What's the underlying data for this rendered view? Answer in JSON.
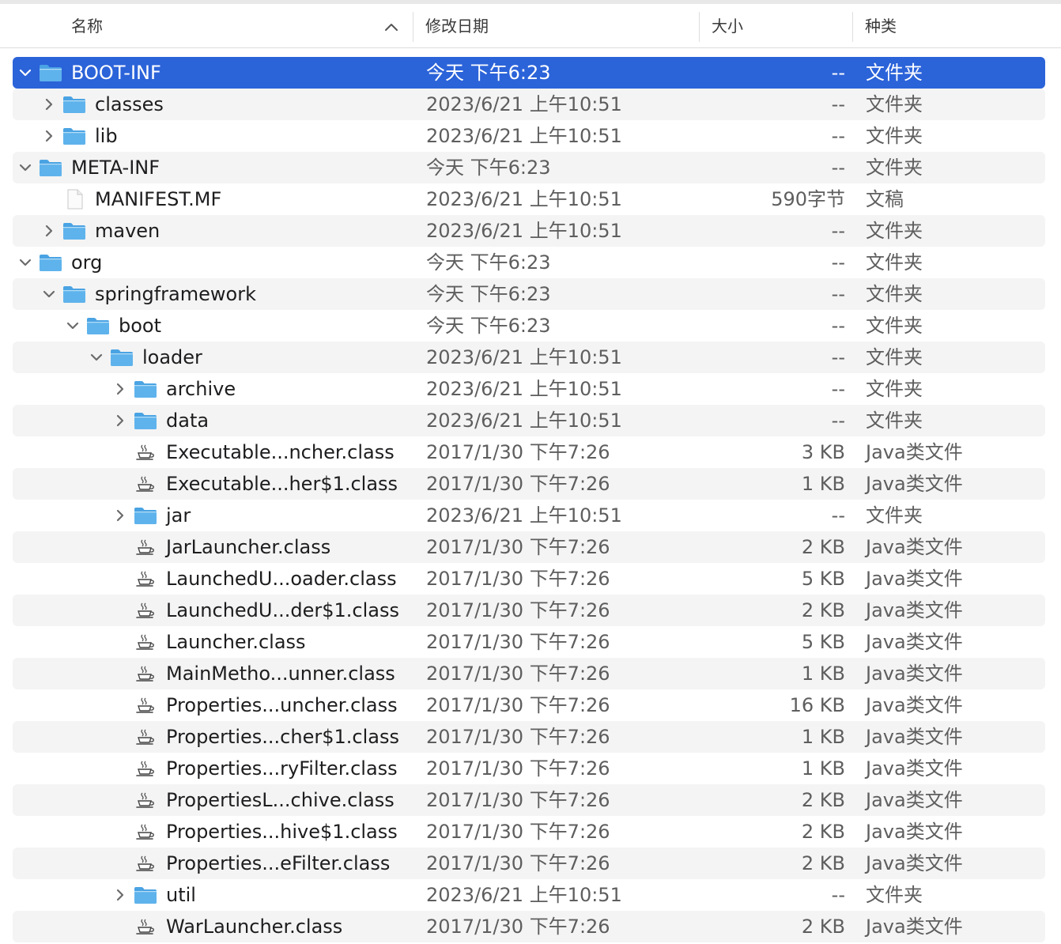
{
  "columns": {
    "name": "名称",
    "date": "修改日期",
    "size": "大小",
    "kind": "种类"
  },
  "colors": {
    "selection": "#2b63d9",
    "folder": "#5fb3ec",
    "stripe": "#f4f4f4"
  },
  "rows": [
    {
      "name": "BOOT-INF",
      "date": "今天 下午6:23",
      "size": "--",
      "kind": "文件夹",
      "depth": 0,
      "type": "folder",
      "chevron": "down",
      "selected": true
    },
    {
      "name": "classes",
      "date": "2023/6/21 上午10:51",
      "size": "--",
      "kind": "文件夹",
      "depth": 1,
      "type": "folder",
      "chevron": "right"
    },
    {
      "name": "lib",
      "date": "2023/6/21 上午10:51",
      "size": "--",
      "kind": "文件夹",
      "depth": 1,
      "type": "folder",
      "chevron": "right"
    },
    {
      "name": "META-INF",
      "date": "今天 下午6:23",
      "size": "--",
      "kind": "文件夹",
      "depth": 0,
      "type": "folder",
      "chevron": "down"
    },
    {
      "name": "MANIFEST.MF",
      "date": "2023/6/21 上午10:51",
      "size": "590字节",
      "kind": "文稿",
      "depth": 1,
      "type": "doc",
      "chevron": "none"
    },
    {
      "name": "maven",
      "date": "2023/6/21 上午10:51",
      "size": "--",
      "kind": "文件夹",
      "depth": 1,
      "type": "folder",
      "chevron": "right"
    },
    {
      "name": "org",
      "date": "今天 下午6:23",
      "size": "--",
      "kind": "文件夹",
      "depth": 0,
      "type": "folder",
      "chevron": "down"
    },
    {
      "name": "springframework",
      "date": "今天 下午6:23",
      "size": "--",
      "kind": "文件夹",
      "depth": 1,
      "type": "folder",
      "chevron": "down"
    },
    {
      "name": "boot",
      "date": "今天 下午6:23",
      "size": "--",
      "kind": "文件夹",
      "depth": 2,
      "type": "folder",
      "chevron": "down"
    },
    {
      "name": "loader",
      "date": "2023/6/21 上午10:51",
      "size": "--",
      "kind": "文件夹",
      "depth": 3,
      "type": "folder",
      "chevron": "down"
    },
    {
      "name": "archive",
      "date": "2023/6/21 上午10:51",
      "size": "--",
      "kind": "文件夹",
      "depth": 4,
      "type": "folder",
      "chevron": "right"
    },
    {
      "name": "data",
      "date": "2023/6/21 上午10:51",
      "size": "--",
      "kind": "文件夹",
      "depth": 4,
      "type": "folder",
      "chevron": "right"
    },
    {
      "name": "Executable...ncher.class",
      "date": "2017/1/30 下午7:26",
      "size": "3 KB",
      "kind": "Java类文件",
      "depth": 4,
      "type": "java",
      "chevron": "none"
    },
    {
      "name": "Executable...her$1.class",
      "date": "2017/1/30 下午7:26",
      "size": "1 KB",
      "kind": "Java类文件",
      "depth": 4,
      "type": "java",
      "chevron": "none"
    },
    {
      "name": "jar",
      "date": "2023/6/21 上午10:51",
      "size": "--",
      "kind": "文件夹",
      "depth": 4,
      "type": "folder",
      "chevron": "right"
    },
    {
      "name": "JarLauncher.class",
      "date": "2017/1/30 下午7:26",
      "size": "2 KB",
      "kind": "Java类文件",
      "depth": 4,
      "type": "java",
      "chevron": "none"
    },
    {
      "name": "LaunchedU...oader.class",
      "date": "2017/1/30 下午7:26",
      "size": "5 KB",
      "kind": "Java类文件",
      "depth": 4,
      "type": "java",
      "chevron": "none"
    },
    {
      "name": "LaunchedU...der$1.class",
      "date": "2017/1/30 下午7:26",
      "size": "2 KB",
      "kind": "Java类文件",
      "depth": 4,
      "type": "java",
      "chevron": "none"
    },
    {
      "name": "Launcher.class",
      "date": "2017/1/30 下午7:26",
      "size": "5 KB",
      "kind": "Java类文件",
      "depth": 4,
      "type": "java",
      "chevron": "none"
    },
    {
      "name": "MainMetho...unner.class",
      "date": "2017/1/30 下午7:26",
      "size": "1 KB",
      "kind": "Java类文件",
      "depth": 4,
      "type": "java",
      "chevron": "none"
    },
    {
      "name": "Properties...uncher.class",
      "date": "2017/1/30 下午7:26",
      "size": "16 KB",
      "kind": "Java类文件",
      "depth": 4,
      "type": "java",
      "chevron": "none"
    },
    {
      "name": "Properties...cher$1.class",
      "date": "2017/1/30 下午7:26",
      "size": "1 KB",
      "kind": "Java类文件",
      "depth": 4,
      "type": "java",
      "chevron": "none"
    },
    {
      "name": "Properties...ryFilter.class",
      "date": "2017/1/30 下午7:26",
      "size": "1 KB",
      "kind": "Java类文件",
      "depth": 4,
      "type": "java",
      "chevron": "none"
    },
    {
      "name": "PropertiesL...chive.class",
      "date": "2017/1/30 下午7:26",
      "size": "2 KB",
      "kind": "Java类文件",
      "depth": 4,
      "type": "java",
      "chevron": "none"
    },
    {
      "name": "Properties...hive$1.class",
      "date": "2017/1/30 下午7:26",
      "size": "2 KB",
      "kind": "Java类文件",
      "depth": 4,
      "type": "java",
      "chevron": "none"
    },
    {
      "name": "Properties...eFilter.class",
      "date": "2017/1/30 下午7:26",
      "size": "2 KB",
      "kind": "Java类文件",
      "depth": 4,
      "type": "java",
      "chevron": "none"
    },
    {
      "name": "util",
      "date": "2023/6/21 上午10:51",
      "size": "--",
      "kind": "文件夹",
      "depth": 4,
      "type": "folder",
      "chevron": "right"
    },
    {
      "name": "WarLauncher.class",
      "date": "2017/1/30 下午7:26",
      "size": "2 KB",
      "kind": "Java类文件",
      "depth": 4,
      "type": "java",
      "chevron": "none"
    }
  ]
}
